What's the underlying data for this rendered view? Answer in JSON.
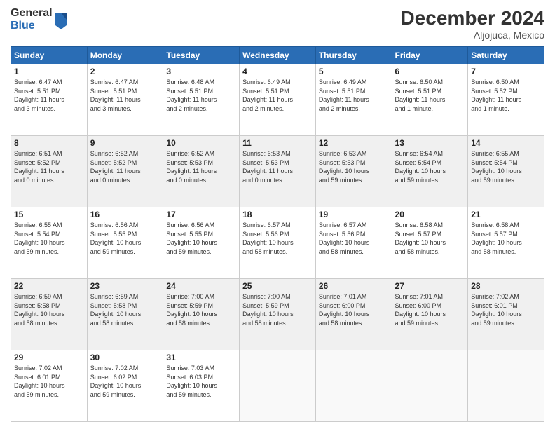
{
  "logo": {
    "general": "General",
    "blue": "Blue"
  },
  "header": {
    "month": "December 2024",
    "location": "Aljojuca, Mexico"
  },
  "weekdays": [
    "Sunday",
    "Monday",
    "Tuesday",
    "Wednesday",
    "Thursday",
    "Friday",
    "Saturday"
  ],
  "weeks": [
    [
      {
        "day": "1",
        "info": "Sunrise: 6:47 AM\nSunset: 5:51 PM\nDaylight: 11 hours\nand 3 minutes."
      },
      {
        "day": "2",
        "info": "Sunrise: 6:47 AM\nSunset: 5:51 PM\nDaylight: 11 hours\nand 3 minutes."
      },
      {
        "day": "3",
        "info": "Sunrise: 6:48 AM\nSunset: 5:51 PM\nDaylight: 11 hours\nand 2 minutes."
      },
      {
        "day": "4",
        "info": "Sunrise: 6:49 AM\nSunset: 5:51 PM\nDaylight: 11 hours\nand 2 minutes."
      },
      {
        "day": "5",
        "info": "Sunrise: 6:49 AM\nSunset: 5:51 PM\nDaylight: 11 hours\nand 2 minutes."
      },
      {
        "day": "6",
        "info": "Sunrise: 6:50 AM\nSunset: 5:51 PM\nDaylight: 11 hours\nand 1 minute."
      },
      {
        "day": "7",
        "info": "Sunrise: 6:50 AM\nSunset: 5:52 PM\nDaylight: 11 hours\nand 1 minute."
      }
    ],
    [
      {
        "day": "8",
        "info": "Sunrise: 6:51 AM\nSunset: 5:52 PM\nDaylight: 11 hours\nand 0 minutes."
      },
      {
        "day": "9",
        "info": "Sunrise: 6:52 AM\nSunset: 5:52 PM\nDaylight: 11 hours\nand 0 minutes."
      },
      {
        "day": "10",
        "info": "Sunrise: 6:52 AM\nSunset: 5:53 PM\nDaylight: 11 hours\nand 0 minutes."
      },
      {
        "day": "11",
        "info": "Sunrise: 6:53 AM\nSunset: 5:53 PM\nDaylight: 11 hours\nand 0 minutes."
      },
      {
        "day": "12",
        "info": "Sunrise: 6:53 AM\nSunset: 5:53 PM\nDaylight: 10 hours\nand 59 minutes."
      },
      {
        "day": "13",
        "info": "Sunrise: 6:54 AM\nSunset: 5:54 PM\nDaylight: 10 hours\nand 59 minutes."
      },
      {
        "day": "14",
        "info": "Sunrise: 6:55 AM\nSunset: 5:54 PM\nDaylight: 10 hours\nand 59 minutes."
      }
    ],
    [
      {
        "day": "15",
        "info": "Sunrise: 6:55 AM\nSunset: 5:54 PM\nDaylight: 10 hours\nand 59 minutes."
      },
      {
        "day": "16",
        "info": "Sunrise: 6:56 AM\nSunset: 5:55 PM\nDaylight: 10 hours\nand 59 minutes."
      },
      {
        "day": "17",
        "info": "Sunrise: 6:56 AM\nSunset: 5:55 PM\nDaylight: 10 hours\nand 59 minutes."
      },
      {
        "day": "18",
        "info": "Sunrise: 6:57 AM\nSunset: 5:56 PM\nDaylight: 10 hours\nand 58 minutes."
      },
      {
        "day": "19",
        "info": "Sunrise: 6:57 AM\nSunset: 5:56 PM\nDaylight: 10 hours\nand 58 minutes."
      },
      {
        "day": "20",
        "info": "Sunrise: 6:58 AM\nSunset: 5:57 PM\nDaylight: 10 hours\nand 58 minutes."
      },
      {
        "day": "21",
        "info": "Sunrise: 6:58 AM\nSunset: 5:57 PM\nDaylight: 10 hours\nand 58 minutes."
      }
    ],
    [
      {
        "day": "22",
        "info": "Sunrise: 6:59 AM\nSunset: 5:58 PM\nDaylight: 10 hours\nand 58 minutes."
      },
      {
        "day": "23",
        "info": "Sunrise: 6:59 AM\nSunset: 5:58 PM\nDaylight: 10 hours\nand 58 minutes."
      },
      {
        "day": "24",
        "info": "Sunrise: 7:00 AM\nSunset: 5:59 PM\nDaylight: 10 hours\nand 58 minutes."
      },
      {
        "day": "25",
        "info": "Sunrise: 7:00 AM\nSunset: 5:59 PM\nDaylight: 10 hours\nand 58 minutes."
      },
      {
        "day": "26",
        "info": "Sunrise: 7:01 AM\nSunset: 6:00 PM\nDaylight: 10 hours\nand 58 minutes."
      },
      {
        "day": "27",
        "info": "Sunrise: 7:01 AM\nSunset: 6:00 PM\nDaylight: 10 hours\nand 59 minutes."
      },
      {
        "day": "28",
        "info": "Sunrise: 7:02 AM\nSunset: 6:01 PM\nDaylight: 10 hours\nand 59 minutes."
      }
    ],
    [
      {
        "day": "29",
        "info": "Sunrise: 7:02 AM\nSunset: 6:01 PM\nDaylight: 10 hours\nand 59 minutes."
      },
      {
        "day": "30",
        "info": "Sunrise: 7:02 AM\nSunset: 6:02 PM\nDaylight: 10 hours\nand 59 minutes."
      },
      {
        "day": "31",
        "info": "Sunrise: 7:03 AM\nSunset: 6:03 PM\nDaylight: 10 hours\nand 59 minutes."
      },
      {
        "day": "",
        "info": ""
      },
      {
        "day": "",
        "info": ""
      },
      {
        "day": "",
        "info": ""
      },
      {
        "day": "",
        "info": ""
      }
    ]
  ]
}
